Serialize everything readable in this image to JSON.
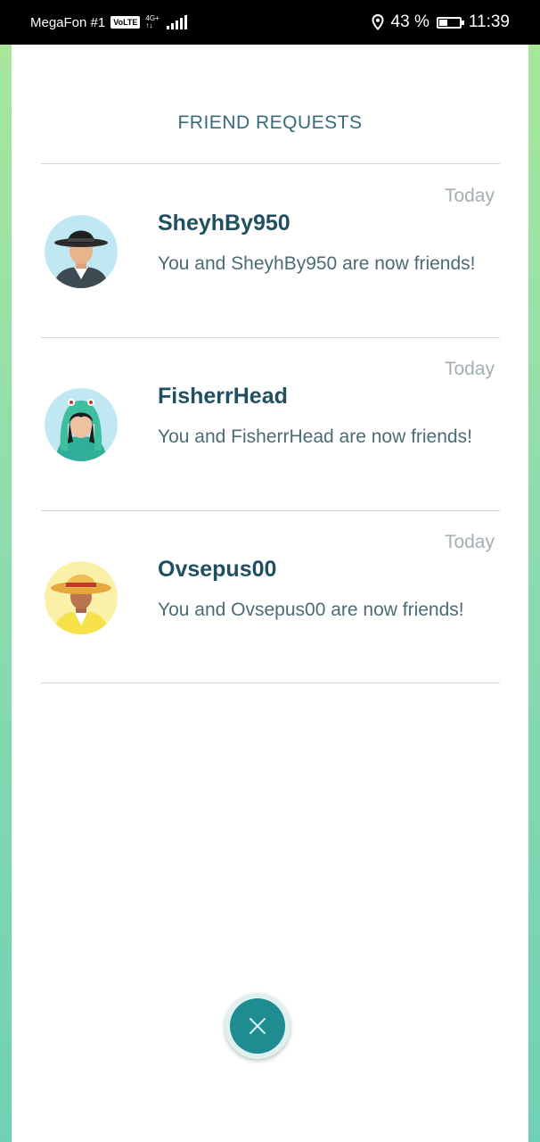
{
  "status_bar": {
    "carrier": "MegaFon #1",
    "volte": "VoLTE",
    "network": "4G+",
    "network_sub": "↑↓",
    "battery": "43 %",
    "battery_level": 0.43,
    "time": "11:39"
  },
  "header": {
    "title": "FRIEND REQUESTS"
  },
  "requests": [
    {
      "name": "SheyhBy950",
      "message": "You and SheyhBy950 are now friends!",
      "time": "Today",
      "avatar": "trainer-avatar-hat"
    },
    {
      "name": "FisherrHead",
      "message": "You and FisherrHead are now friends!",
      "time": "Today",
      "avatar": "trainer-avatar-bulbasaur-hood"
    },
    {
      "name": "Ovsepus00",
      "message": "You and Ovsepus00 are now friends!",
      "time": "Today",
      "avatar": "trainer-avatar-straw-hat"
    }
  ],
  "close_button": {
    "icon": "close-icon"
  },
  "colors": {
    "accent": "#1f8c92",
    "name": "#1f4f60",
    "title": "#386a7a"
  }
}
